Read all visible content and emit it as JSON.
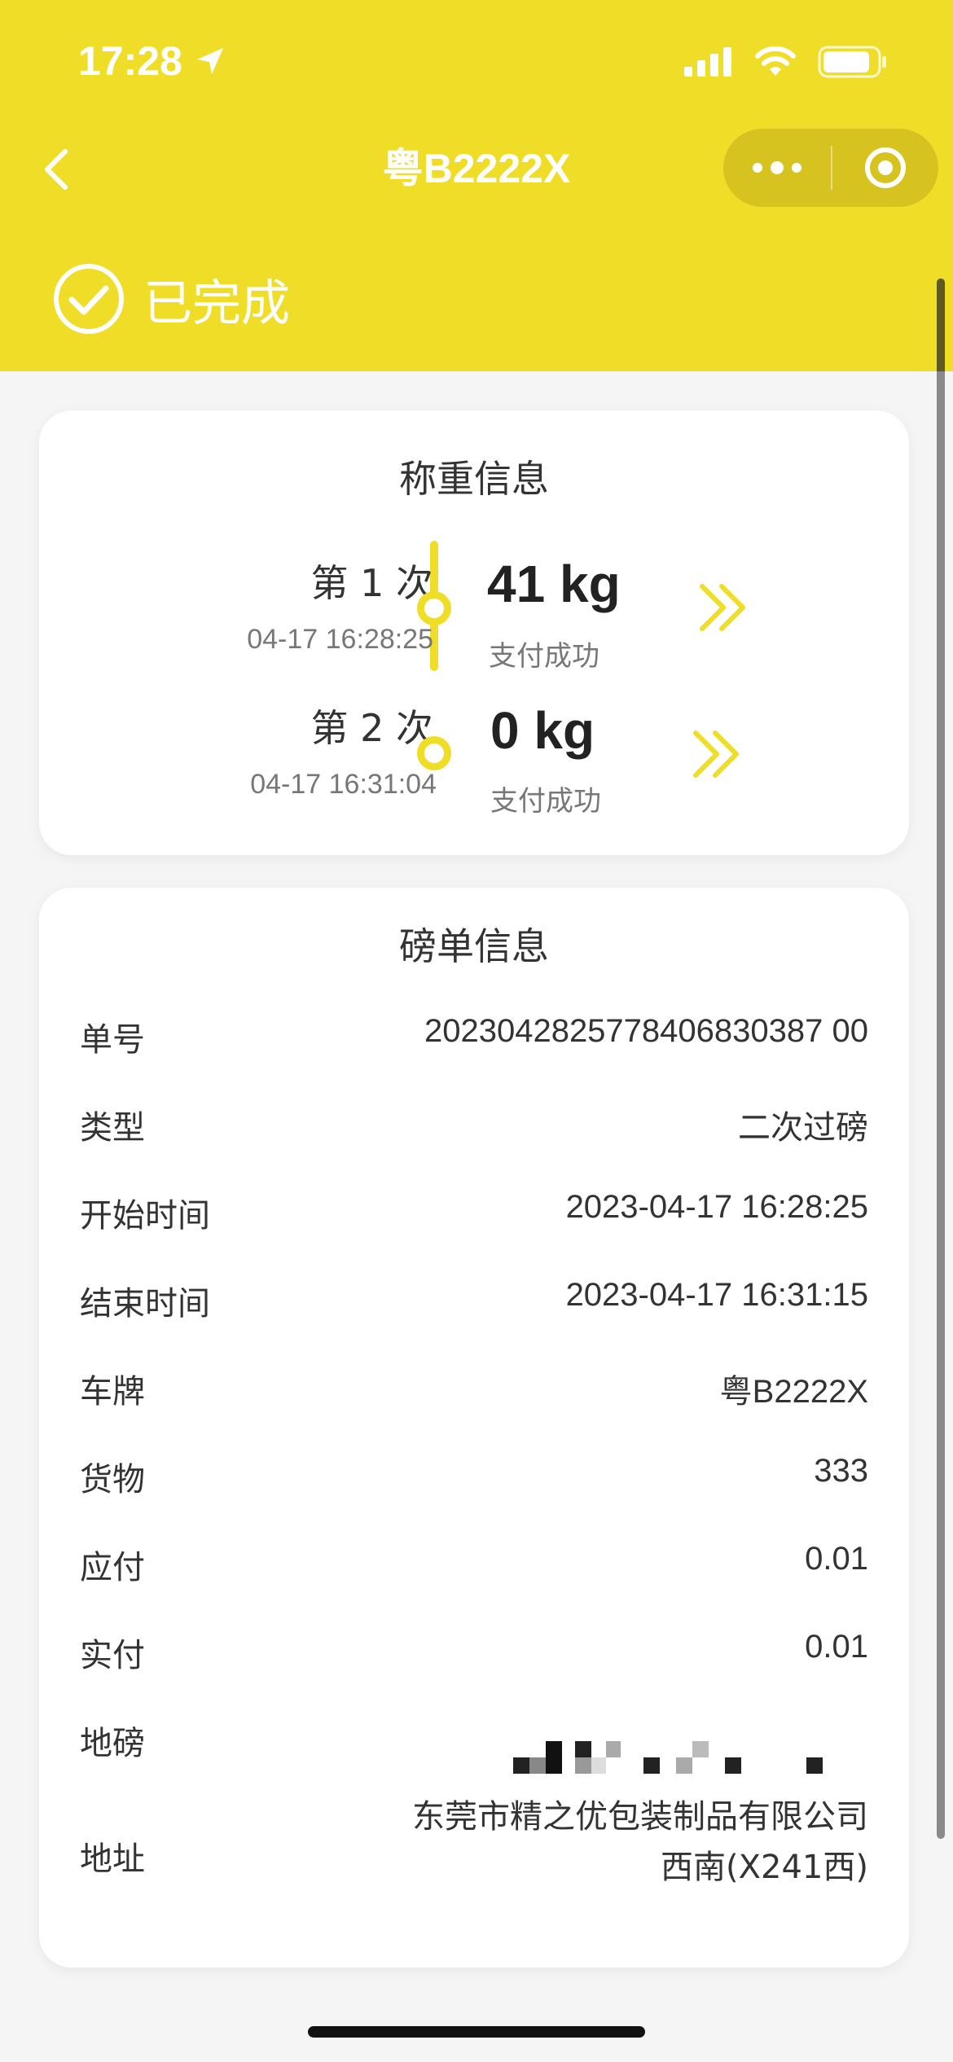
{
  "status_bar": {
    "time": "17:28"
  },
  "nav": {
    "title": "粤B2222X"
  },
  "order_status": {
    "label": "已完成"
  },
  "weigh_card": {
    "title": "称重信息",
    "entries": [
      {
        "label": "第 1 次",
        "time": "04-17 16:28:25",
        "weight": "41 kg",
        "pay_status": "支付成功"
      },
      {
        "label": "第 2 次",
        "time": "04-17 16:31:04",
        "weight": "0 kg",
        "pay_status": "支付成功"
      }
    ]
  },
  "ticket_card": {
    "title": "磅单信息",
    "rows": [
      {
        "label": "单号",
        "value": "2023042825778406830387 00"
      },
      {
        "label": "类型",
        "value": "二次过磅"
      },
      {
        "label": "开始时间",
        "value": "2023-04-17 16:28:25"
      },
      {
        "label": "结束时间",
        "value": "2023-04-17 16:31:15"
      },
      {
        "label": "车牌",
        "value": "粤B2222X"
      },
      {
        "label": "货物",
        "value": "333"
      },
      {
        "label": "应付",
        "value": "0.01"
      },
      {
        "label": "实付",
        "value": "0.01"
      }
    ],
    "scale_label": "地磅",
    "address_label": "地址",
    "address_line1": "东莞市精之优包装制品有限公司",
    "address_line2": "西南(X241西)"
  },
  "colors": {
    "accent": "#f0dd27",
    "background": "#f5f5f5"
  }
}
